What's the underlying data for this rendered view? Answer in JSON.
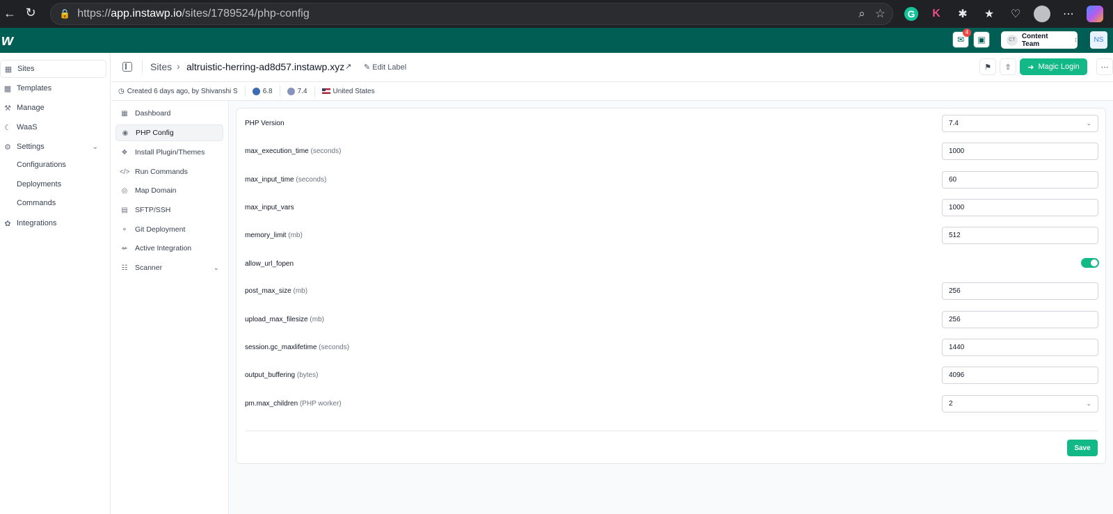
{
  "browser": {
    "url_prefix": "https://",
    "url_host": "app.instawp.io",
    "url_path": "/sites/1789524/php-config"
  },
  "header": {
    "notification_count": "4",
    "team_avatar": "CT",
    "team_name": "Content Team",
    "user_initials": "NS"
  },
  "sidebar": {
    "items": [
      {
        "label": "Sites",
        "icon": "sites-icon"
      },
      {
        "label": "Templates",
        "icon": "templates-icon"
      },
      {
        "label": "Manage",
        "icon": "manage-icon"
      },
      {
        "label": "WaaS",
        "icon": "waas-icon"
      },
      {
        "label": "Settings",
        "icon": "gear-icon"
      },
      {
        "label": "Integrations",
        "icon": "integrations-icon"
      }
    ],
    "settings_sub": [
      "Configurations",
      "Deployments",
      "Commands"
    ]
  },
  "topbar": {
    "crumb_root": "Sites",
    "site_name": "altruistic-herring-ad8d57.instawp.xyz",
    "edit_label": "Edit Label",
    "magic_login": "Magic Login"
  },
  "meta": {
    "created": "Created 6 days ago, by Shivanshi S",
    "wp_version": "6.8",
    "php_version": "7.4",
    "country": "United States"
  },
  "subnav": {
    "items": [
      {
        "label": "Dashboard"
      },
      {
        "label": "PHP Config"
      },
      {
        "label": "Install Plugin/Themes"
      },
      {
        "label": "Run Commands"
      },
      {
        "label": "Map Domain"
      },
      {
        "label": "SFTP/SSH"
      },
      {
        "label": "Git Deployment"
      },
      {
        "label": "Active Integration"
      },
      {
        "label": "Scanner"
      }
    ]
  },
  "php_config": {
    "rows": [
      {
        "name": "PHP Version",
        "unit": "",
        "value": "7.4"
      },
      {
        "name": "max_execution_time",
        "unit": "(seconds)",
        "value": "1000"
      },
      {
        "name": "max_input_time",
        "unit": "(seconds)",
        "value": "60"
      },
      {
        "name": "max_input_vars",
        "unit": "",
        "value": "1000"
      },
      {
        "name": "memory_limit",
        "unit": "(mb)",
        "value": "512"
      },
      {
        "name": "allow_url_fopen",
        "unit": "",
        "value": "on"
      },
      {
        "name": "post_max_size",
        "unit": "(mb)",
        "value": "256"
      },
      {
        "name": "upload_max_filesize",
        "unit": "(mb)",
        "value": "256"
      },
      {
        "name": "session.gc_maxlifetime",
        "unit": "(seconds)",
        "value": "1440"
      },
      {
        "name": "output_buffering",
        "unit": "(bytes)",
        "value": "4096"
      },
      {
        "name": "pm.max_children",
        "unit": "(PHP worker)",
        "value": "2"
      }
    ],
    "save_label": "Save"
  },
  "colors": {
    "header_bg": "#005e54",
    "accent": "#12b886"
  }
}
